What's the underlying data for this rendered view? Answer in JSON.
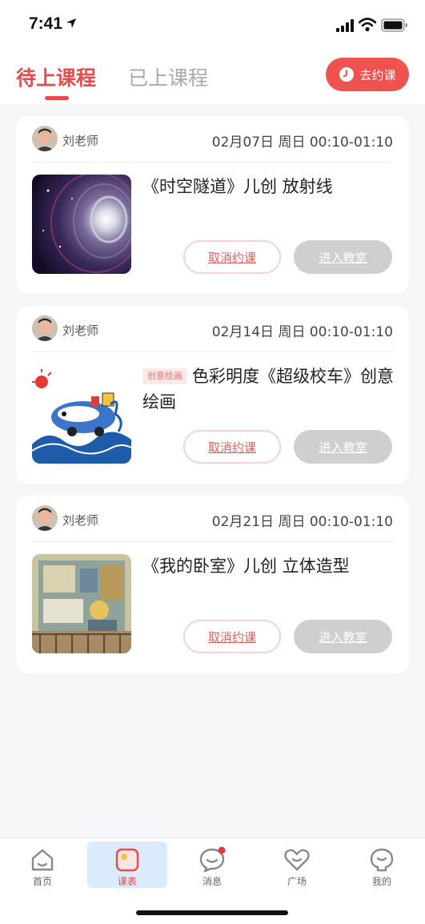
{
  "status_bar": {
    "time": "7:41"
  },
  "header": {
    "tab_upcoming": "待上课程",
    "tab_past": "已上课程",
    "book_button": "去约课"
  },
  "courses": [
    {
      "teacher": "刘老师",
      "datetime": "02月07日 周日 00:10-01:10",
      "tag": "",
      "title": "《时空隧道》儿创 放射线",
      "cancel": "取消约课",
      "enter": "进入教室"
    },
    {
      "teacher": "刘老师",
      "datetime": "02月14日 周日 00:10-01:10",
      "tag": "创意绘画",
      "title": "色彩明度《超级校车》创意绘画",
      "cancel": "取消约课",
      "enter": "进入教室"
    },
    {
      "teacher": "刘老师",
      "datetime": "02月21日 周日 00:10-01:10",
      "tag": "",
      "title": "《我的卧室》儿创 立体造型",
      "cancel": "取消约课",
      "enter": "进入教室"
    }
  ],
  "tabbar": {
    "items": [
      {
        "label": "首页",
        "icon": "home-icon"
      },
      {
        "label": "课表",
        "icon": "schedule-icon",
        "active": true
      },
      {
        "label": "消息",
        "icon": "message-icon",
        "badge": true
      },
      {
        "label": "广场",
        "icon": "heart-icon"
      },
      {
        "label": "我的",
        "icon": "profile-icon"
      }
    ]
  },
  "colors": {
    "accent": "#e64d4f",
    "background": "#f6f5f7",
    "disabled_button": "#cfcfcf"
  }
}
